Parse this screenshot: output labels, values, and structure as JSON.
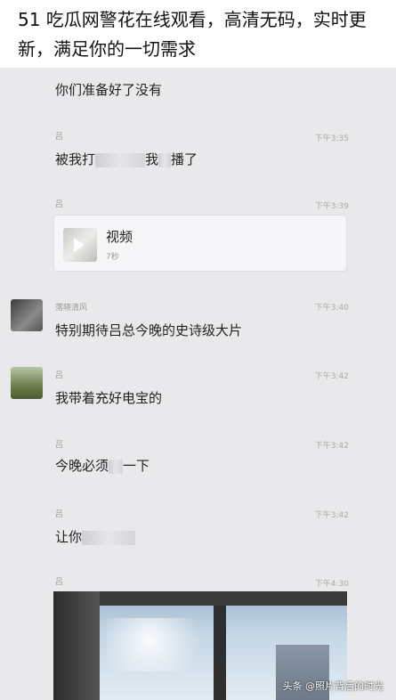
{
  "overlay": {
    "title": "51 吃瓜网警花在线观看，高清无码，实时更新，满足你的一切需求"
  },
  "messages": [
    {
      "sender": "",
      "time": "",
      "text": "你们准备好了没有"
    },
    {
      "sender": "吕",
      "time": "下午3:35",
      "text_a": "被我打",
      "text_b": "我",
      "text_c": "播了"
    },
    {
      "sender": "吕",
      "time": "下午3:39",
      "video_label": "视频",
      "video_duration": "7秒"
    },
    {
      "sender": "落晓清风",
      "time": "下午3:40",
      "text": "特别期待吕总今晚的史诗级大片"
    },
    {
      "sender": "吕",
      "time": "下午3:42",
      "text": "我带着充好电宝的"
    },
    {
      "sender": "吕",
      "time": "下午3:42",
      "text_a": "今晚必须",
      "text_b": "一下"
    },
    {
      "sender": "吕",
      "time": "下午3:42",
      "text": "让你"
    },
    {
      "sender": "吕",
      "time": "下午4:30"
    }
  ],
  "watermark": "头条 @照片背后的时光"
}
